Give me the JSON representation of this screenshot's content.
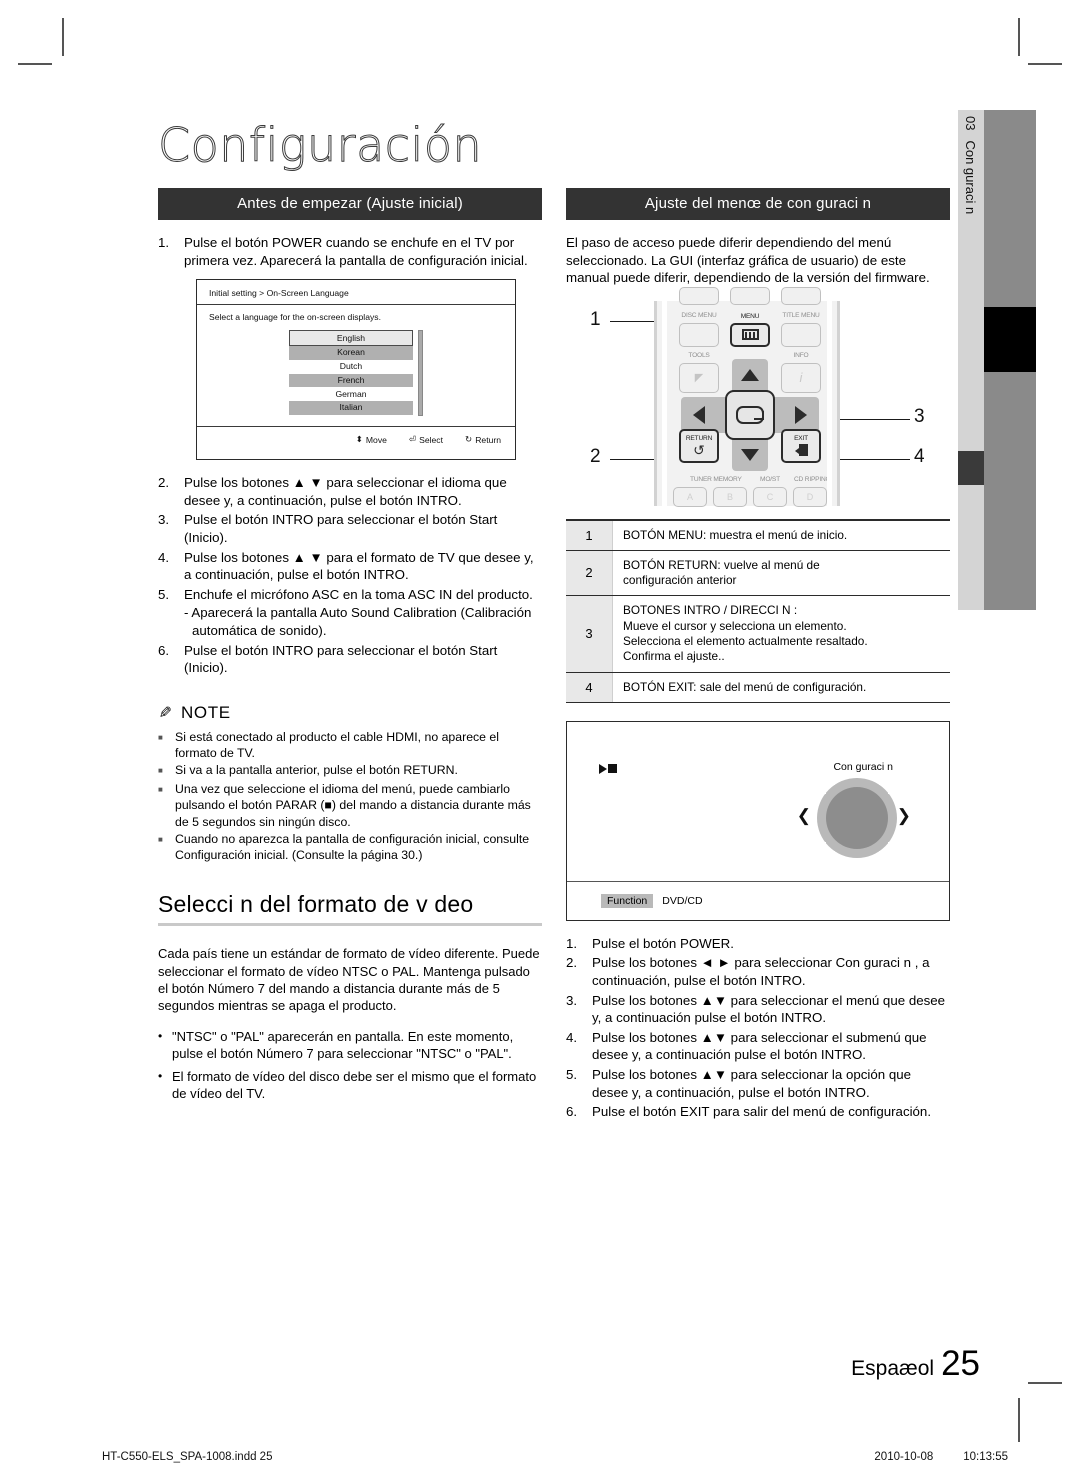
{
  "chapter": {
    "title": "Configuración",
    "tab_number": "03",
    "tab_label": "Con  guraci n"
  },
  "left_column": {
    "section_title": "Antes de empezar (Ajuste inicial)",
    "steps": [
      {
        "num": "1.",
        "text": "Pulse el botón POWER cuando se enchufe en el TV por primera vez. Aparecerá la pantalla de configuración inicial."
      },
      {
        "num": "2.",
        "text": "Pulse los botones ▲ ▼ para seleccionar el idioma que desee y, a continuación, pulse el botón INTRO."
      },
      {
        "num": "3.",
        "text": "Pulse el botón INTRO para seleccionar el botón Start (Inicio)."
      },
      {
        "num": "4.",
        "text": "Pulse los botones ▲ ▼ para el formato de TV que desee y, a continuación, pulse el botón INTRO."
      },
      {
        "num": "5.",
        "text": "Enchufe el micrófono ASC en la toma ASC IN del producto.",
        "sub": "- Aparecerá la pantalla Auto Sound Calibration (Calibración automática de sonido)."
      },
      {
        "num": "6.",
        "text": "Pulse el botón INTRO para seleccionar el botón Start (Inicio)."
      }
    ],
    "language_screen": {
      "breadcrumb": "Initial setting > On-Screen Language",
      "description": "Select a language for the on-screen displays.",
      "options": [
        {
          "label": "English",
          "state": "selected"
        },
        {
          "label": "Korean",
          "state": "alt"
        },
        {
          "label": "Dutch",
          "state": "plain"
        },
        {
          "label": "French",
          "state": "alt"
        },
        {
          "label": "German",
          "state": "plain"
        },
        {
          "label": "Italian",
          "state": "alt"
        }
      ],
      "footer": [
        {
          "icon": "updown-icon",
          "glyph": "⬍",
          "label": "Move"
        },
        {
          "icon": "enter-icon",
          "glyph": "⏎",
          "label": "Select"
        },
        {
          "icon": "return-icon",
          "glyph": "↻",
          "label": "Return"
        }
      ]
    },
    "note": {
      "heading": "NOTE",
      "items": [
        "Si está conectado al producto el cable HDMI, no aparece el formato de TV.",
        "Si va a la pantalla anterior, pulse el botón RETURN.",
        "Una vez que seleccione el idioma del menú, puede cambiarlo pulsando el botón PARAR (■) del mando a distancia durante más de 5 segundos sin ningún disco.",
        "Cuando no aparezca la pantalla de configuración inicial, consulte Configuración inicial. (Consulte la página 30.)"
      ]
    },
    "video_format": {
      "heading": "Selecci n del formato de v deo",
      "paragraph": "Cada país tiene un estándar de formato de vídeo diferente. Puede seleccionar el formato de vídeo NTSC o PAL. Mantenga pulsado el botón Número 7 del mando a distancia durante más de 5 segundos mientras se apaga el producto.",
      "bullets": [
        "\"NTSC\" o \"PAL\" aparecerán en pantalla. En este momento, pulse el botón Número 7 para seleccionar \"NTSC\" o \"PAL\".",
        "El formato de vídeo del disco debe ser el mismo que el formato de vídeo del TV."
      ]
    }
  },
  "right_column": {
    "section_title": "Ajuste del menœ de con  guraci n",
    "intro": "El paso de acceso puede diferir dependiendo del menú seleccionado. La GUI (interfaz gráfica de usuario) de este manual puede diferir, dependiendo de la versión del firmware.",
    "remote": {
      "callouts": [
        "1",
        "2",
        "3",
        "4"
      ],
      "buttons": {
        "disc_menu": "DISC MENU",
        "menu": "MENU",
        "title_menu": "TITLE MENU",
        "tools": "TOOLS",
        "info": "INFO",
        "return": "RETURN",
        "exit": "EXIT",
        "tuner_memory": "TUNER MEMORY",
        "mo_st": "MO/ST",
        "cd_ripping": "CD RIPPING",
        "abcd": [
          "A",
          "B",
          "C",
          "D"
        ]
      }
    },
    "legend": [
      {
        "num": "1",
        "lines": [
          "BOTÓN MENU: muestra el menú de inicio."
        ]
      },
      {
        "num": "2",
        "lines": [
          "BOTÓN RETURN: vuelve al menú de",
          "configuración anterior"
        ]
      },
      {
        "num": "3",
        "lines": [
          "BOTONES INTRO / DIRECCI N  :",
          "Mueve el cursor y selecciona un elemento.",
          "Selecciona el elemento actualmente resaltado.",
          "Confirma el ajuste.."
        ]
      },
      {
        "num": "4",
        "lines": [
          "BOTÓN EXIT: sale del menú de configuración."
        ]
      }
    ],
    "tv_mock": {
      "setup_label": "Con  guraci n",
      "function_label": "Function",
      "function_value": "DVD/CD"
    },
    "steps": [
      {
        "num": "1.",
        "text": "Pulse el botón POWER."
      },
      {
        "num": "2.",
        "text": "Pulse los botones ◄ ► para seleccionar Con  guraci n , a continuación, pulse el botón INTRO."
      },
      {
        "num": "3.",
        "text": "Pulse los botones ▲▼ para seleccionar el menú que desee y, a continuación pulse el botón INTRO."
      },
      {
        "num": "4.",
        "text": "Pulse los botones ▲▼ para seleccionar el submenú que desee y, a continuación pulse el botón INTRO."
      },
      {
        "num": "5.",
        "text": "Pulse los botones ▲▼ para seleccionar la opción que desee y, a continuación, pulse el botón INTRO."
      },
      {
        "num": "6.",
        "text": "Pulse el botón EXIT para salir del menú de configuración."
      }
    ]
  },
  "page": {
    "language_label": "Espaæol",
    "number": "25",
    "file_name": "HT-C550-ELS_SPA-1008.indd   25",
    "date": "2010-10-08",
    "time": "10:13:55"
  }
}
